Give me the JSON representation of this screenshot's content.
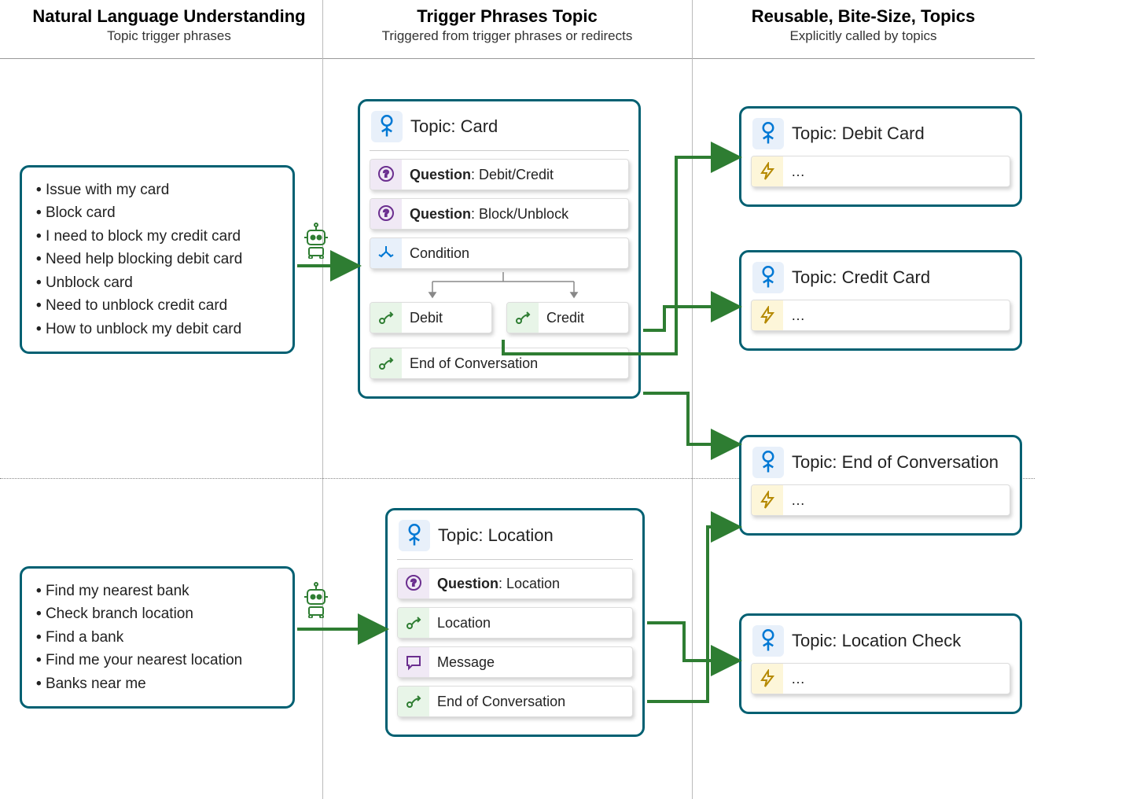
{
  "columns": [
    {
      "title": "Natural Language Understanding",
      "subtitle": "Topic trigger phrases"
    },
    {
      "title": "Trigger Phrases Topic",
      "subtitle": "Triggered from trigger phrases or redirects"
    },
    {
      "title": "Reusable, Bite-Size, Topics",
      "subtitle": "Explicitly called by topics"
    }
  ],
  "phrases": {
    "card": [
      "Issue with my card",
      "Block card",
      "I need to block my credit card",
      "Need help blocking debit card",
      "Unblock card",
      "Need to unblock credit card",
      "How to unblock my debit card"
    ],
    "location": [
      "Find my nearest bank",
      "Check branch location",
      "Find a bank",
      "Find me your nearest location",
      "Banks near me"
    ]
  },
  "topics": {
    "card": {
      "title": "Topic: Card",
      "q1_bold": "Question",
      "q1_rest": ": Debit/Credit",
      "q2_bold": "Question",
      "q2_rest": ": Block/Unblock",
      "cond": "Condition",
      "debit": "Debit",
      "credit": "Credit",
      "eoc": "End of Conversation"
    },
    "location": {
      "title": "Topic: Location",
      "q_bold": "Question",
      "q_rest": ": Location",
      "loc": "Location",
      "msg": "Message",
      "eoc": "End of Conversation"
    }
  },
  "reusable": {
    "debit": "Topic: Debit Card",
    "credit": "Topic: Credit Card",
    "eoc": "Topic: End of Conversation",
    "loccheck": "Topic: Location Check",
    "dots": "…"
  }
}
